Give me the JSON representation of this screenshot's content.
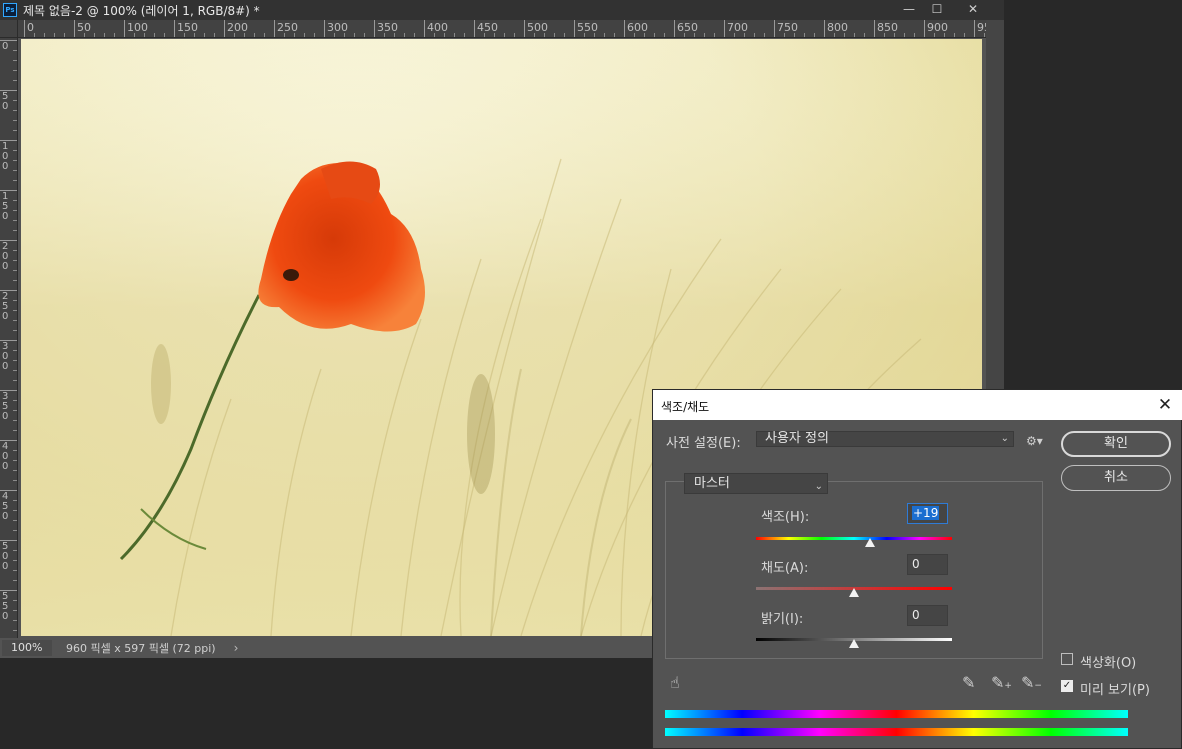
{
  "document": {
    "title": "제목 없음-2 @ 100% (레이어 1, RGB/8#) *",
    "logo_text": "Ps",
    "h_ruler_labels": [
      "0",
      "50",
      "100",
      "150",
      "200",
      "250",
      "300",
      "350",
      "400",
      "450",
      "500",
      "550",
      "600",
      "650",
      "700",
      "750",
      "800",
      "850",
      "900",
      "95"
    ],
    "v_ruler_labels": [
      "0",
      "50",
      "100",
      "150",
      "200",
      "250",
      "300",
      "350",
      "400",
      "450",
      "500",
      "550"
    ],
    "status": {
      "zoom": "100%",
      "info": "960 픽셀 x 597 픽셀 (72 ppi)",
      "arrow": "›"
    },
    "window_buttons": {
      "minimize": "—",
      "maximize": "☐",
      "close": "✕"
    }
  },
  "dialog": {
    "title": "색조/채도",
    "close": "✕",
    "preset_label": "사전 설정(E):",
    "preset_value": "사용자 정의",
    "ok_label": "확인",
    "cancel_label": "취소",
    "channel_value": "마스터",
    "hue": {
      "label": "색조(H):",
      "value": "+19",
      "level": 0.58
    },
    "saturation": {
      "label": "채도(A):",
      "value": "0",
      "level": 0.5
    },
    "lightness": {
      "label": "밝기(I):",
      "value": "0",
      "level": 0.5
    },
    "colorize": {
      "label": "색상화(O)",
      "checked": false
    },
    "preview": {
      "label": "미리 보기(P)",
      "checked": true
    },
    "icons": [
      "targeted-adjustment-hand-icon",
      "eyedropper-icon",
      "eyedropper-plus-icon",
      "eyedropper-minus-icon",
      "gear-icon"
    ]
  }
}
